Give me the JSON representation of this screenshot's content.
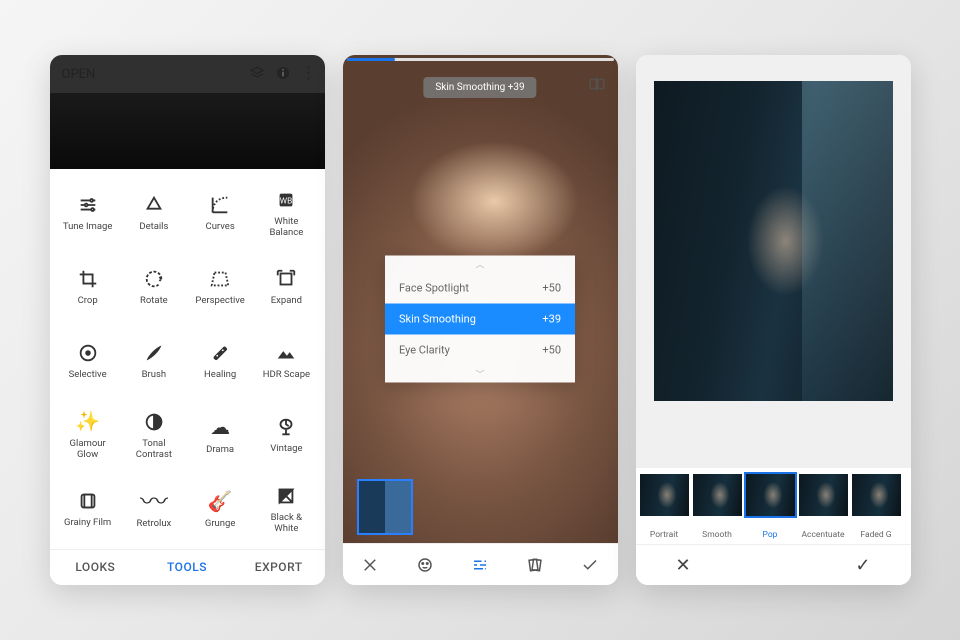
{
  "left": {
    "open": "OPEN",
    "tools": [
      {
        "label": "Tune Image"
      },
      {
        "label": "Details"
      },
      {
        "label": "Curves"
      },
      {
        "label": "White\nBalance"
      },
      {
        "label": "Crop"
      },
      {
        "label": "Rotate"
      },
      {
        "label": "Perspective"
      },
      {
        "label": "Expand"
      },
      {
        "label": "Selective"
      },
      {
        "label": "Brush"
      },
      {
        "label": "Healing"
      },
      {
        "label": "HDR Scape"
      },
      {
        "label": "Glamour\nGlow"
      },
      {
        "label": "Tonal\nContrast"
      },
      {
        "label": "Drama"
      },
      {
        "label": "Vintage"
      },
      {
        "label": "Grainy Film"
      },
      {
        "label": "Retrolux"
      },
      {
        "label": "Grunge"
      },
      {
        "label": "Black &\nWhite"
      }
    ],
    "tabs": {
      "looks": "LOOKS",
      "tools": "TOOLS",
      "export": "EXPORT"
    }
  },
  "middle": {
    "chip": "Skin Smoothing +39",
    "menu": [
      {
        "name": "Face Spotlight",
        "val": "+50",
        "selected": false
      },
      {
        "name": "Skin Smoothing",
        "val": "+39",
        "selected": true
      },
      {
        "name": "Eye Clarity",
        "val": "+50",
        "selected": false
      }
    ]
  },
  "right": {
    "looks": [
      {
        "label": "Portrait"
      },
      {
        "label": "Smooth"
      },
      {
        "label": "Pop",
        "active": true
      },
      {
        "label": "Accentuate"
      },
      {
        "label": "Faded G"
      }
    ]
  }
}
